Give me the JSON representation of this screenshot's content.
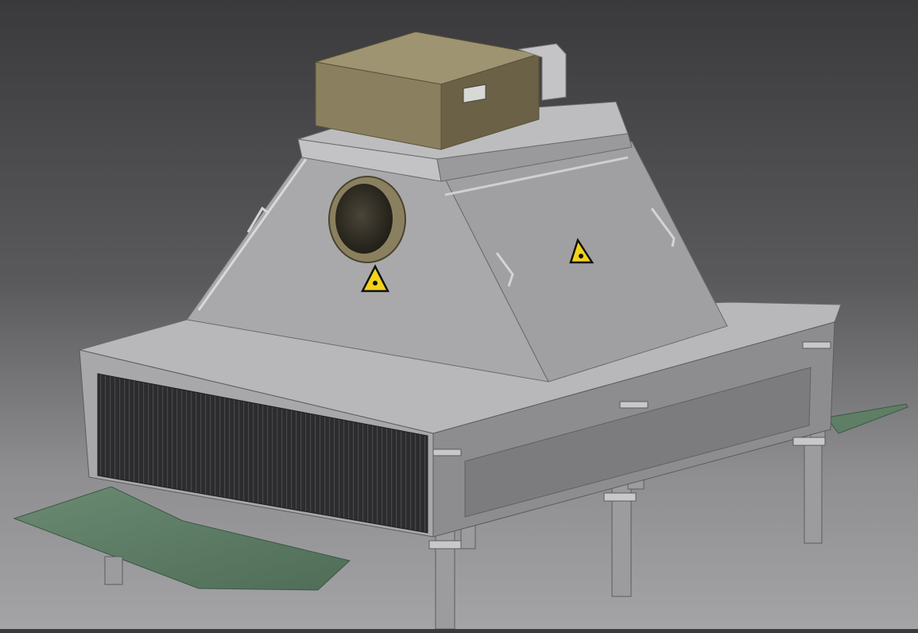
{
  "scene": {
    "subject": "cad-model-industrial-heat-exchanger-hood",
    "colors": {
      "background_top": "#3a3a3c",
      "background_bottom": "#a4a4a6",
      "steel_light": "#b4b4b6",
      "steel_mid": "#9a9a9c",
      "steel_dark": "#6f6f71",
      "enclosure_top": "#8c8261",
      "enclosure_side": "#6e6548",
      "fin_pack": "#2c2c2e",
      "membrane": "#5e7e66",
      "warning_yellow": "#f2d21b"
    },
    "icons": [
      "warning-triangle-icon",
      "round-porthole-icon",
      "handle-icon",
      "nameplate-icon"
    ],
    "visible_text": []
  }
}
